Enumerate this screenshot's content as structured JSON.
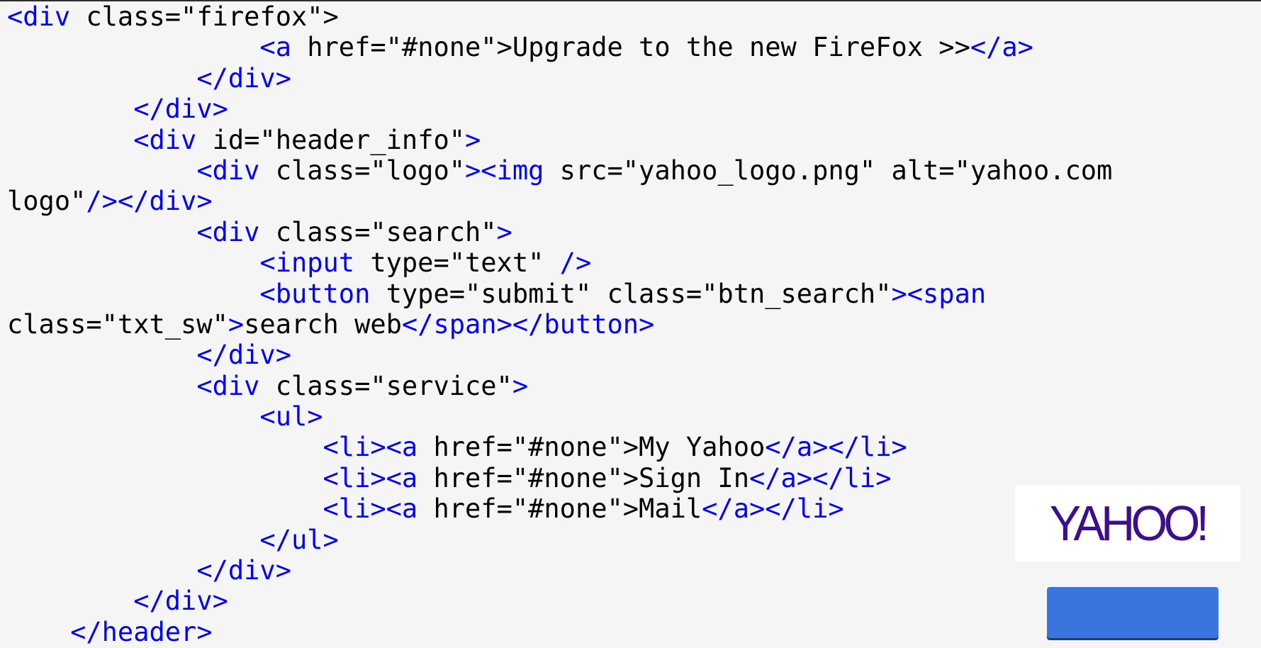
{
  "code_lines": [
    [
      {
        "t": "tag",
        "v": "<div"
      },
      {
        "t": "text",
        "v": " class=\"firefox\">"
      }
    ],
    [
      {
        "t": "text",
        "v": "                "
      },
      {
        "t": "tag",
        "v": "<a"
      },
      {
        "t": "text",
        "v": " href=\"#none\">Upgrade to the new FireFox >>"
      },
      {
        "t": "tag",
        "v": "</a>"
      }
    ],
    [
      {
        "t": "text",
        "v": "            "
      },
      {
        "t": "tag",
        "v": "</div>"
      }
    ],
    [
      {
        "t": "text",
        "v": "        "
      },
      {
        "t": "tag",
        "v": "</div>"
      }
    ],
    [
      {
        "t": "text",
        "v": "        "
      },
      {
        "t": "tag",
        "v": "<div"
      },
      {
        "t": "text",
        "v": " id=\"header_info\""
      },
      {
        "t": "tag",
        "v": ">"
      }
    ],
    [
      {
        "t": "text",
        "v": "            "
      },
      {
        "t": "tag",
        "v": "<div"
      },
      {
        "t": "text",
        "v": " class=\"logo\""
      },
      {
        "t": "tag",
        "v": "><img"
      },
      {
        "t": "text",
        "v": " src=\"yahoo_logo.png\" alt=\"yahoo.com"
      }
    ],
    [
      {
        "t": "text",
        "v": "logo\""
      },
      {
        "t": "tag",
        "v": "/></div>"
      }
    ],
    [
      {
        "t": "text",
        "v": "            "
      },
      {
        "t": "tag",
        "v": "<div"
      },
      {
        "t": "text",
        "v": " class=\"search\""
      },
      {
        "t": "tag",
        "v": ">"
      }
    ],
    [
      {
        "t": "text",
        "v": "                "
      },
      {
        "t": "tag",
        "v": "<input"
      },
      {
        "t": "text",
        "v": " type=\"text\" "
      },
      {
        "t": "tag",
        "v": "/>"
      }
    ],
    [
      {
        "t": "text",
        "v": "                "
      },
      {
        "t": "tag",
        "v": "<button"
      },
      {
        "t": "text",
        "v": " type=\"submit\" class=\"btn_search\""
      },
      {
        "t": "tag",
        "v": "><span"
      }
    ],
    [
      {
        "t": "text",
        "v": "class=\"txt_sw\""
      },
      {
        "t": "tag",
        "v": ">"
      },
      {
        "t": "text",
        "v": "search web"
      },
      {
        "t": "tag",
        "v": "</span></button>"
      }
    ],
    [
      {
        "t": "text",
        "v": "            "
      },
      {
        "t": "tag",
        "v": "</div>"
      }
    ],
    [
      {
        "t": "text",
        "v": "            "
      },
      {
        "t": "tag",
        "v": "<div"
      },
      {
        "t": "text",
        "v": " class=\"service\""
      },
      {
        "t": "tag",
        "v": ">"
      }
    ],
    [
      {
        "t": "text",
        "v": "                "
      },
      {
        "t": "tag",
        "v": "<ul>"
      }
    ],
    [
      {
        "t": "text",
        "v": "                    "
      },
      {
        "t": "tag",
        "v": "<li><a"
      },
      {
        "t": "text",
        "v": " href=\"#none\">My Yahoo"
      },
      {
        "t": "tag",
        "v": "</a></li>"
      }
    ],
    [
      {
        "t": "text",
        "v": "                    "
      },
      {
        "t": "tag",
        "v": "<li><a"
      },
      {
        "t": "text",
        "v": " href=\"#none\">Sign In"
      },
      {
        "t": "tag",
        "v": "</a></li>"
      }
    ],
    [
      {
        "t": "text",
        "v": "                    "
      },
      {
        "t": "tag",
        "v": "<li><a"
      },
      {
        "t": "text",
        "v": " href=\"#none\">Mail"
      },
      {
        "t": "tag",
        "v": "</a></li>"
      }
    ],
    [
      {
        "t": "text",
        "v": "                "
      },
      {
        "t": "tag",
        "v": "</ul>"
      }
    ],
    [
      {
        "t": "text",
        "v": "            "
      },
      {
        "t": "tag",
        "v": "</div>"
      }
    ],
    [
      {
        "t": "text",
        "v": "        "
      },
      {
        "t": "tag",
        "v": "</div>"
      }
    ],
    [
      {
        "t": "text",
        "v": "    "
      },
      {
        "t": "tag",
        "v": "</header>"
      }
    ]
  ],
  "preview": {
    "logo_text": "YAHOO!",
    "button_label": ""
  },
  "colors": {
    "tag": "#0000ff",
    "text": "#000000",
    "background": "#f5f5f5",
    "logo": "#3f0e8f",
    "button": "#3a75de"
  },
  "icons": {
    "logo": "yahoo-logo-icon"
  }
}
